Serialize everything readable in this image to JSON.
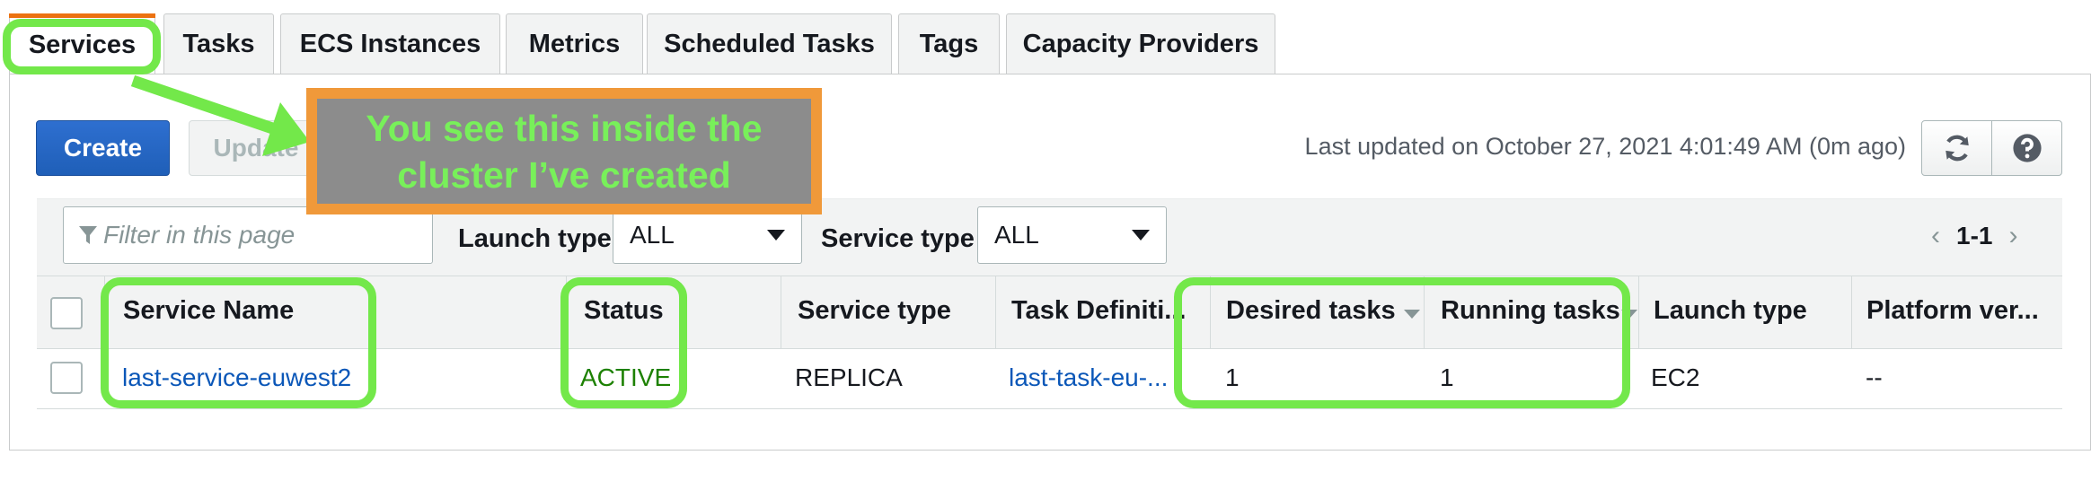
{
  "tabs": [
    {
      "label": "Services",
      "active": true
    },
    {
      "label": "Tasks"
    },
    {
      "label": "ECS Instances"
    },
    {
      "label": "Metrics"
    },
    {
      "label": "Scheduled Tasks"
    },
    {
      "label": "Tags"
    },
    {
      "label": "Capacity Providers"
    }
  ],
  "toolbar": {
    "create_label": "Create",
    "update_label": "Update",
    "last_updated": "Last updated on October 27, 2021 4:01:49 AM (0m ago)",
    "refresh_icon": "refresh-icon",
    "help_icon": "help-icon"
  },
  "filter": {
    "placeholder": "Filter in this page",
    "launch_type_label": "Launch type",
    "launch_type_value": "ALL",
    "service_type_label": "Service type",
    "service_type_value": "ALL",
    "page_range": "1-1"
  },
  "table": {
    "columns": [
      "Service Name",
      "Status",
      "Service type",
      "Task Definiti...",
      "Desired tasks",
      "Running tasks",
      "Launch type",
      "Platform ver..."
    ],
    "rows": [
      {
        "service_name": "last-service-euwest2",
        "status": "ACTIVE",
        "service_type": "REPLICA",
        "task_definition": "last-task-eu-...",
        "desired_tasks": "1",
        "running_tasks": "1",
        "launch_type": "EC2",
        "platform_version": "--"
      }
    ]
  },
  "annotation": {
    "text": "You see this inside the cluster I’ve created",
    "highlight_color": "#73e84a",
    "box_color": "#f0993a"
  },
  "colors": {
    "accent": "#ec7211",
    "primary_button": "#1f5fb8",
    "link": "#0b57b8",
    "status_active": "#1d8102"
  }
}
